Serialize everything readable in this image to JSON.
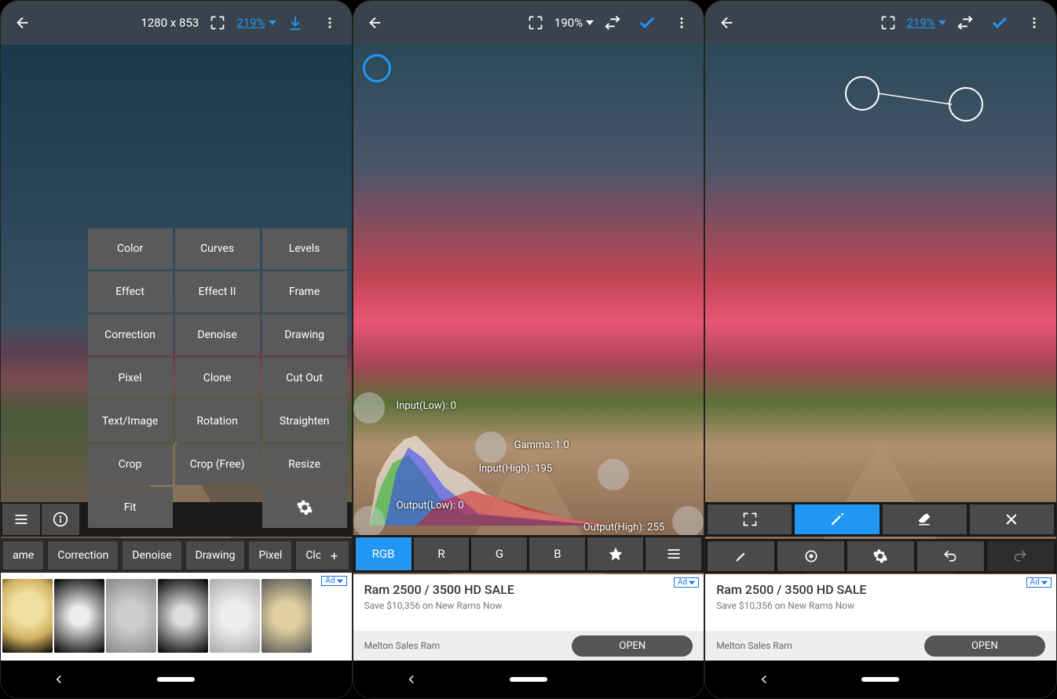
{
  "screen1": {
    "dimensions": "1280 x 853",
    "zoom": "219%",
    "tool_grid": [
      "Color",
      "Curves",
      "Levels",
      "Effect",
      "Effect II",
      "Frame",
      "Correction",
      "Denoise",
      "Drawing",
      "Pixel",
      "Clone",
      "Cut Out",
      "Text/Image",
      "Rotation",
      "Straighten",
      "Crop",
      "Crop (Free)",
      "Resize",
      "Fit",
      "",
      ""
    ],
    "bottom_tabs": [
      "ame",
      "Correction",
      "Denoise",
      "Drawing",
      "Pixel",
      "Clo"
    ],
    "ad_label": "Ad"
  },
  "screen2": {
    "zoom": "190%",
    "levels": {
      "input_low_label": "Input(Low):",
      "input_low": "0",
      "gamma_label": "Gamma:",
      "gamma": "1.0",
      "input_high_label": "Input(High):",
      "input_high": "195",
      "output_low_label": "Output(Low):",
      "output_low": "0",
      "output_high_label": "Output(High):",
      "output_high": "255"
    },
    "channels": [
      "RGB",
      "R",
      "G",
      "B"
    ],
    "ad": {
      "title": "Ram 2500 / 3500 HD SALE",
      "sub": "Save $10,356 on New Rams Now",
      "src": "Melton Sales Ram",
      "open": "OPEN",
      "label": "Ad"
    }
  },
  "screen3": {
    "zoom": "219%",
    "ad": {
      "title": "Ram 2500 / 3500 HD SALE",
      "sub": "Save $10,356 on New Rams Now",
      "src": "Melton Sales Ram",
      "open": "OPEN",
      "label": "Ad"
    }
  }
}
